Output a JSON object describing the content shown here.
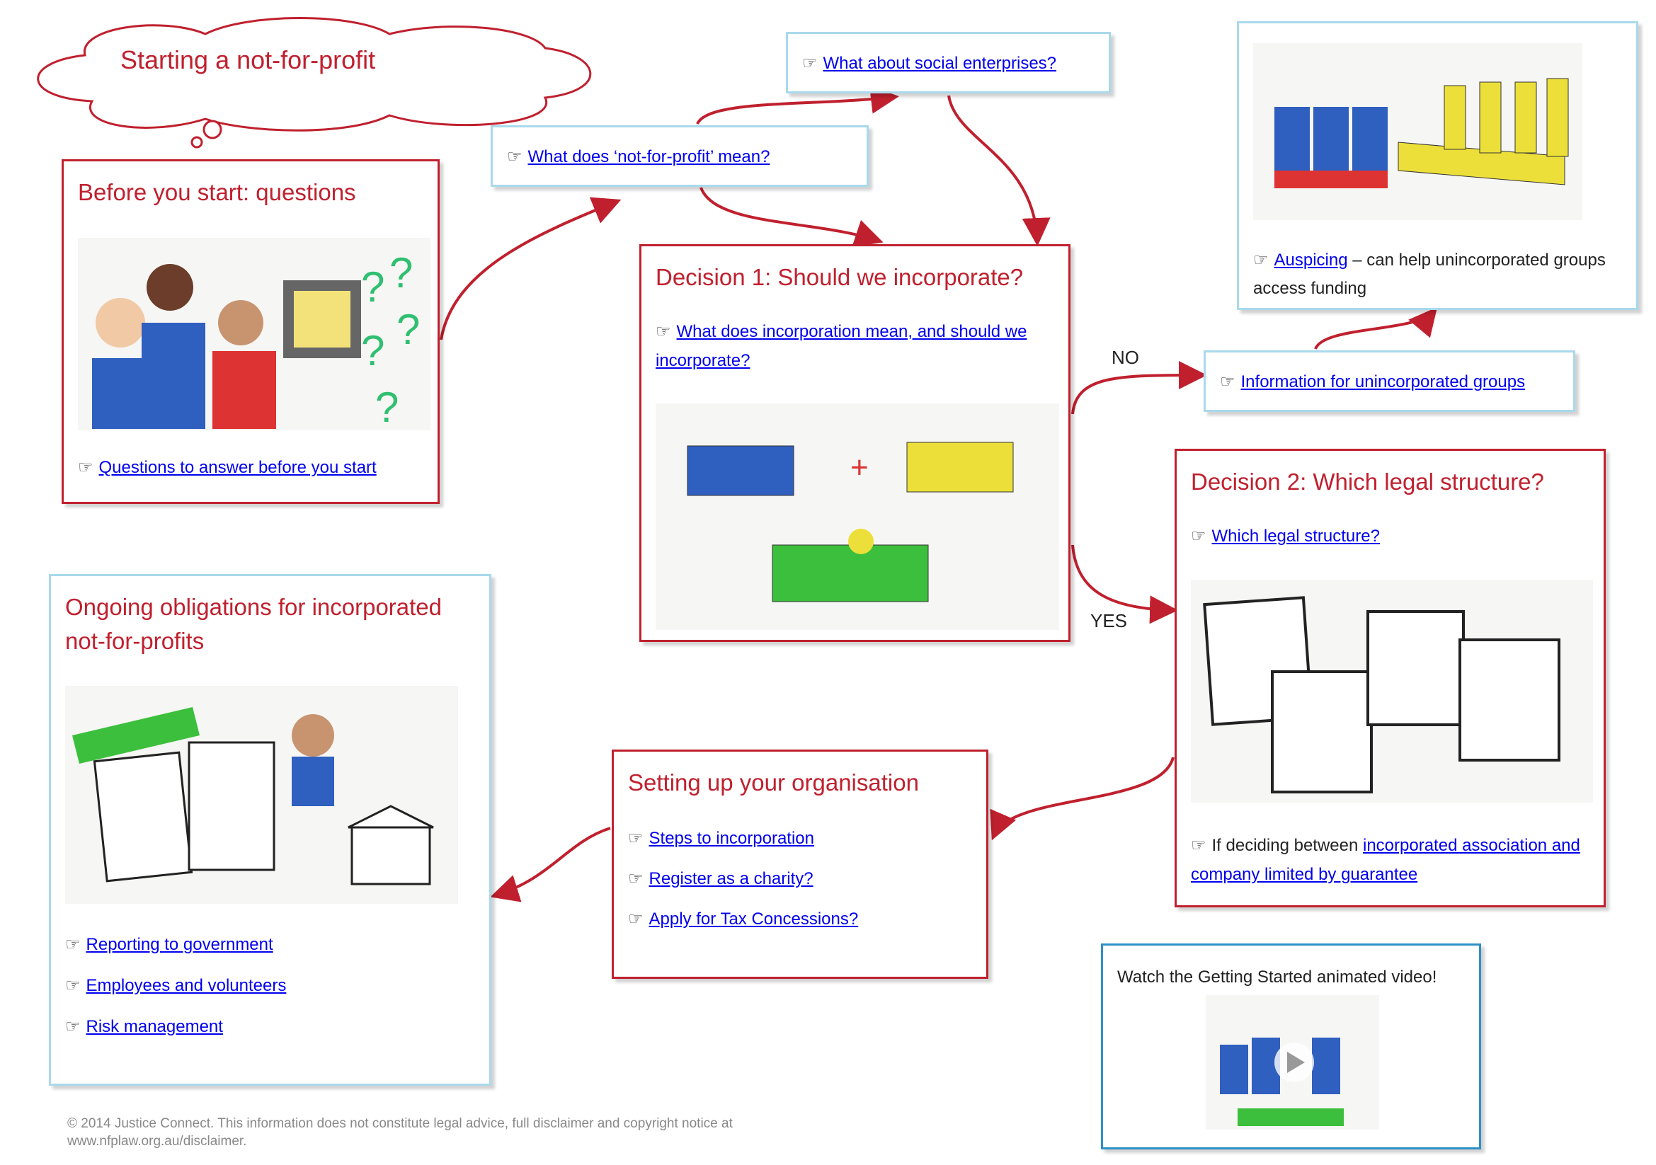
{
  "title": "Starting a not-for-profit",
  "before": {
    "title": "Before you start: questions",
    "link": "Questions to answer before you start"
  },
  "nfp_meaning": {
    "link": "What does ‘not-for-profit’ mean?"
  },
  "social": {
    "link": "What about social enterprises?"
  },
  "auspicing": {
    "link": "Auspicing",
    "text": " – can help unincorporated groups access funding"
  },
  "decision1": {
    "title": "Decision 1: Should we incorporate?",
    "link": "What does incorporation mean, and should we incorporate?"
  },
  "unincorporated": {
    "link": "Information for unincorporated groups"
  },
  "decision2": {
    "title": "Decision 2: Which legal structure?",
    "link": "Which legal structure?",
    "prefix": "If deciding between ",
    "link2": "incorporated association and company limited by guarantee"
  },
  "ongoing": {
    "title": "Ongoing obligations for incorporated not-for-profits",
    "links": [
      "Reporting to government",
      "Employees and volunteers",
      "Risk management"
    ]
  },
  "setup": {
    "title": "Setting up your organisation",
    "links": [
      "Steps to incorporation",
      "Register as a charity?",
      "Apply for Tax Concessions?"
    ]
  },
  "video": {
    "text": "Watch the Getting Started animated video!"
  },
  "arrows": {
    "no": "NO",
    "yes": "YES"
  },
  "footer": "© 2014 Justice Connect. This information does not constitute legal advice, full disclaimer and copyright notice at www.nfplaw.org.au/disclaimer.",
  "colors": {
    "accent": "#c0202e",
    "border_blue": "#a9d9ec",
    "link": "#0000ee"
  },
  "icons": {
    "link_marker": "pointing-hand-icon"
  }
}
